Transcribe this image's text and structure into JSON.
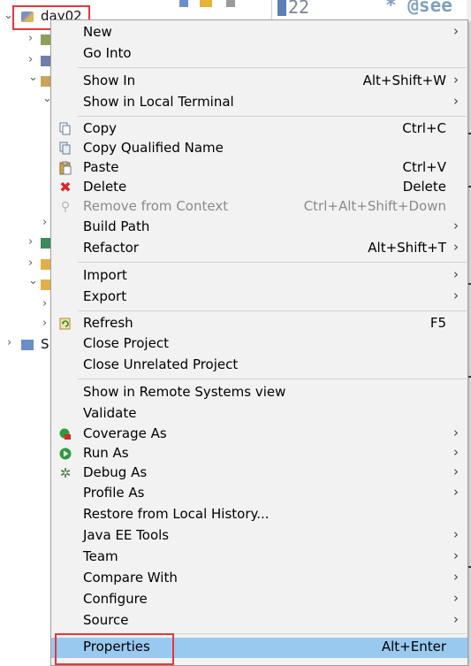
{
  "explorer": {
    "selected_project": "day02",
    "partial_label": "S"
  },
  "editor": {
    "line_number": "22",
    "code_fragment": "* @see"
  },
  "menu": {
    "items": [
      {
        "label": "New",
        "shortcut": "",
        "submenu": true,
        "icon": ""
      },
      {
        "label": "Go Into",
        "shortcut": "",
        "submenu": false,
        "icon": ""
      },
      {
        "label": "Show In",
        "shortcut": "Alt+Shift+W",
        "submenu": true,
        "icon": ""
      },
      {
        "label": "Show in Local Terminal",
        "shortcut": "",
        "submenu": true,
        "icon": ""
      },
      {
        "label": "Copy",
        "shortcut": "Ctrl+C",
        "submenu": false,
        "icon": "copy-icon"
      },
      {
        "label": "Copy Qualified Name",
        "shortcut": "",
        "submenu": false,
        "icon": "copy-qualified-name-icon"
      },
      {
        "label": "Paste",
        "shortcut": "Ctrl+V",
        "submenu": false,
        "icon": "paste-icon"
      },
      {
        "label": "Delete",
        "shortcut": "Delete",
        "submenu": false,
        "icon": "delete-icon"
      },
      {
        "label": "Remove from Context",
        "shortcut": "Ctrl+Alt+Shift+Down",
        "submenu": false,
        "icon": "remove-context-icon",
        "disabled": true
      },
      {
        "label": "Build Path",
        "shortcut": "",
        "submenu": true,
        "icon": ""
      },
      {
        "label": "Refactor",
        "shortcut": "Alt+Shift+T",
        "submenu": true,
        "icon": ""
      },
      {
        "label": "Import",
        "shortcut": "",
        "submenu": true,
        "icon": ""
      },
      {
        "label": "Export",
        "shortcut": "",
        "submenu": true,
        "icon": ""
      },
      {
        "label": "Refresh",
        "shortcut": "F5",
        "submenu": false,
        "icon": "refresh-icon"
      },
      {
        "label": "Close Project",
        "shortcut": "",
        "submenu": false,
        "icon": ""
      },
      {
        "label": "Close Unrelated Project",
        "shortcut": "",
        "submenu": false,
        "icon": ""
      },
      {
        "label": "Show in Remote Systems view",
        "shortcut": "",
        "submenu": false,
        "icon": ""
      },
      {
        "label": "Validate",
        "shortcut": "",
        "submenu": false,
        "icon": ""
      },
      {
        "label": "Coverage As",
        "shortcut": "",
        "submenu": true,
        "icon": "coverage-icon"
      },
      {
        "label": "Run As",
        "shortcut": "",
        "submenu": true,
        "icon": "run-icon"
      },
      {
        "label": "Debug As",
        "shortcut": "",
        "submenu": true,
        "icon": "debug-icon"
      },
      {
        "label": "Profile As",
        "shortcut": "",
        "submenu": true,
        "icon": ""
      },
      {
        "label": "Restore from Local History...",
        "shortcut": "",
        "submenu": false,
        "icon": ""
      },
      {
        "label": "Java EE Tools",
        "shortcut": "",
        "submenu": true,
        "icon": ""
      },
      {
        "label": "Team",
        "shortcut": "",
        "submenu": true,
        "icon": ""
      },
      {
        "label": "Compare With",
        "shortcut": "",
        "submenu": true,
        "icon": ""
      },
      {
        "label": "Configure",
        "shortcut": "",
        "submenu": true,
        "icon": ""
      },
      {
        "label": "Source",
        "shortcut": "",
        "submenu": true,
        "icon": ""
      },
      {
        "label": "Properties",
        "shortcut": "Alt+Enter",
        "submenu": false,
        "icon": "",
        "highlighted": true
      }
    ]
  },
  "colors": {
    "highlight": "#99c9ef",
    "annotation_box": "#e8363b",
    "menu_background": "#f2f2f2"
  }
}
